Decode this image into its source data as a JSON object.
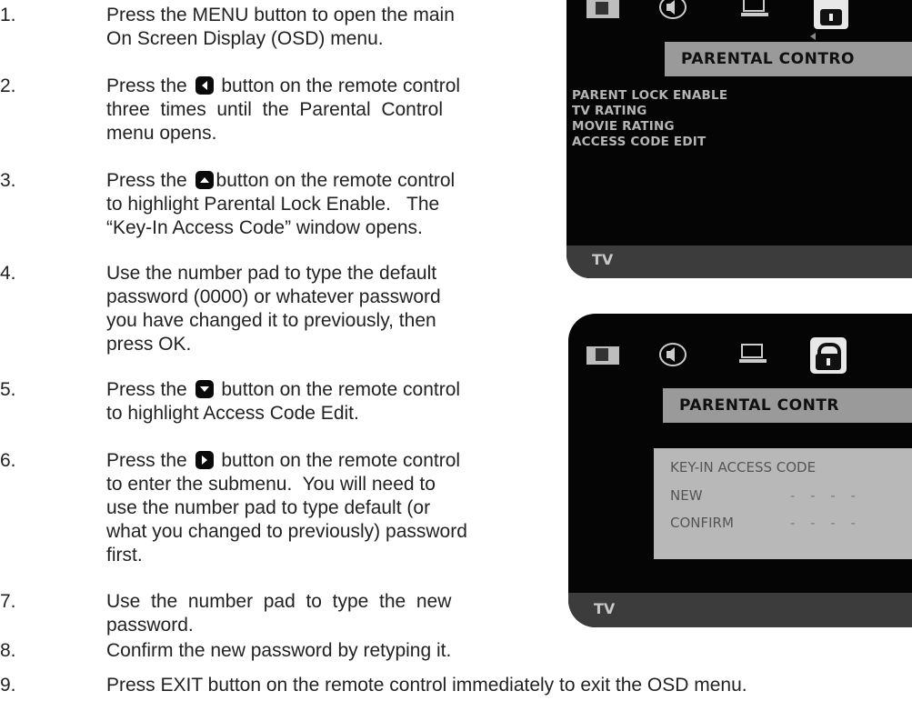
{
  "steps": [
    {
      "num": "1.",
      "lines": [
        "Press the MENU button to open the main",
        "On Screen Display (OSD) menu."
      ]
    },
    {
      "num": "2.",
      "lines": [
        [
          "Press the ",
          "left-button-icon",
          " button on the remote control"
        ],
        "three  times  until  the  Parental  Control",
        "menu opens."
      ]
    },
    {
      "num": "3.",
      "lines": [
        [
          "Press the ",
          "up-button-icon",
          "button on the remote control"
        ],
        "to highlight Parental Lock Enable.   The",
        "“Key-In Access Code” window opens."
      ]
    },
    {
      "num": "4.",
      "lines": [
        "Use the number pad to type the default",
        "password (0000) or whatever password",
        "you have changed it to previously, then",
        "press OK."
      ]
    },
    {
      "num": "5.",
      "lines": [
        [
          "Press the ",
          "down-button-icon",
          " button on the remote control"
        ],
        "to highlight Access Code Edit."
      ]
    },
    {
      "num": "6.",
      "lines": [
        [
          "Press the ",
          "right-button-icon",
          " button on the remote control"
        ],
        "to enter the submenu.  You will need to",
        "use the number pad to type default (or",
        "what you changed to previously) password",
        "first."
      ]
    },
    {
      "num": "7.",
      "lines": [
        "Use  the  number  pad  to  type  the  new",
        "password."
      ]
    },
    {
      "num": "8.",
      "lines": [
        "Confirm the new password by retyping it."
      ]
    },
    {
      "num": "9.",
      "lines": [
        "Press EXIT button on the remote control immediately to exit the OSD menu."
      ]
    }
  ],
  "screen1": {
    "title": "PARENTAL CONTRO",
    "menu_items": [
      "PARENT LOCK ENABLE",
      "TV RATING",
      "MOVIE RATING",
      "ACCESS CODE EDIT"
    ],
    "footer": "TV"
  },
  "screen2": {
    "title": "PARENTAL CONTR",
    "dialog": {
      "heading": "KEY-IN ACCESS CODE",
      "new_label": "NEW",
      "new_value": "- - - -",
      "confirm_label": "CONFIRM",
      "confirm_value": "- - - -"
    },
    "footer": "TV"
  },
  "colors": {
    "osd_background": "#050505",
    "osd_title_bar": "#9a9a9a",
    "osd_footer": "#3c3c3c",
    "osd_menu_text": "#b5b5b5"
  }
}
